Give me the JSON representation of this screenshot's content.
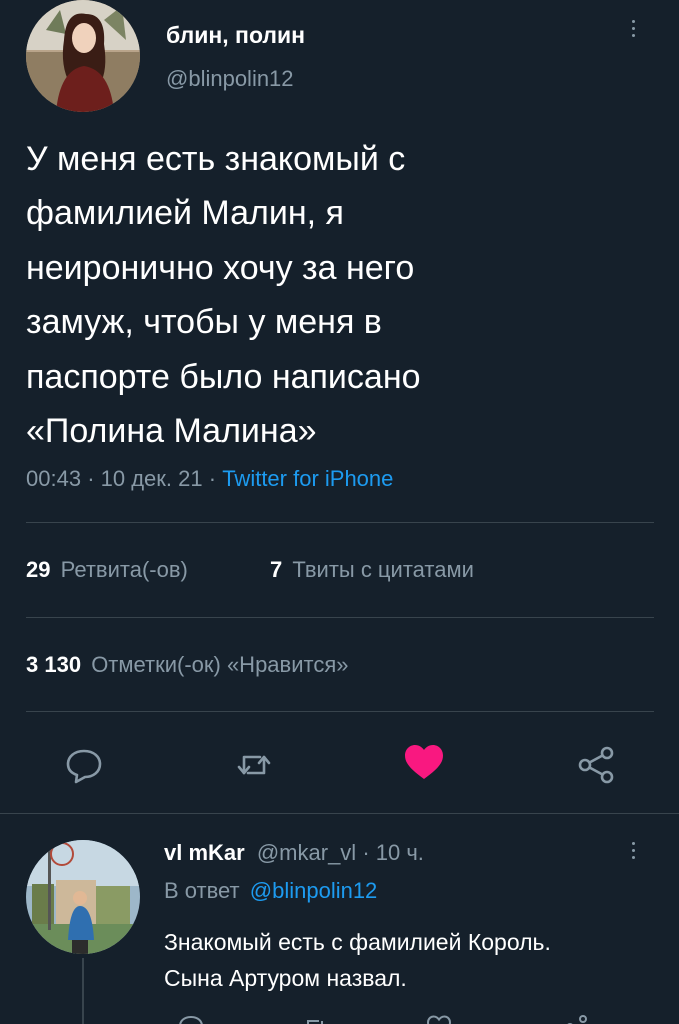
{
  "tweet": {
    "author_name": "блин, полин",
    "author_handle": "@blinpolin12",
    "text_lines": [
      "У меня есть знакомый с",
      "фамилией Малин, я",
      "неиронично хочу за него",
      "замуж, чтобы у меня в",
      "паспорте было написано",
      "«Полина Малина»"
    ],
    "time": "00:43",
    "date": "10 дек. 21",
    "source": "Twitter for iPhone",
    "retweets_count": "29",
    "retweets_label": "Ретвита(-ов)",
    "quotes_count": "7",
    "quotes_label": "Твиты с цитатами",
    "likes_count": "3 130",
    "likes_label": "Отметки(-ок) «Нравится»"
  },
  "reply": {
    "author_name": "vl mKar",
    "author_handle": "@mkar_vl",
    "age": "10 ч.",
    "reply_to_prefix": "В ответ",
    "reply_to_handle": "@blinpolin12",
    "text_lines": [
      "Знакомый есть с фамилией Король.",
      "Сына Артуром назвал."
    ]
  },
  "colors": {
    "background": "#15202b",
    "muted": "#8899a6",
    "link": "#1d9bf0",
    "like": "#f91880",
    "divider": "#38444d"
  },
  "icons": [
    "reply-icon",
    "retweet-icon",
    "like-icon",
    "share-icon",
    "more-icon"
  ]
}
